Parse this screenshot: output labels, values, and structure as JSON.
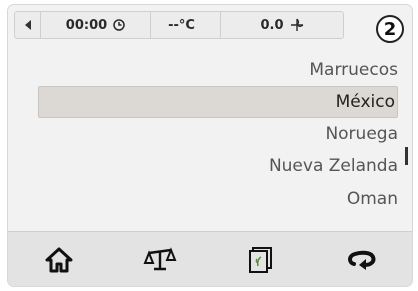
{
  "statusbar": {
    "time": "00:00",
    "temperature": "--°C",
    "wind": "0.0"
  },
  "step_badge": "2",
  "countries": {
    "items": [
      {
        "label": "Marruecos",
        "selected": false
      },
      {
        "label": "México",
        "selected": true
      },
      {
        "label": "Noruega",
        "selected": false
      },
      {
        "label": "Nueva Zelanda",
        "selected": false
      },
      {
        "label": "Oman",
        "selected": false
      }
    ]
  },
  "bottom_bar": {
    "buttons": [
      "home-icon",
      "scale-icon",
      "recipe-book-icon",
      "back-arrow-icon"
    ]
  },
  "colors": {
    "selected_row": "#dcd8d3",
    "background": "#f2f2f2"
  }
}
